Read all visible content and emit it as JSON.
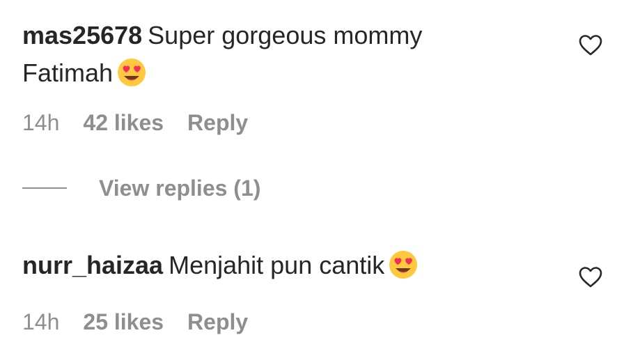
{
  "comments": [
    {
      "username": "mas25678",
      "text_line1": "Super gorgeous mommy",
      "text_line2": "Fatimah",
      "emoji": "heart-eyes-emoji",
      "time": "14h",
      "likes": "42 likes",
      "reply": "Reply",
      "view_replies": "View replies (1)"
    },
    {
      "username": "nurr_haizaa",
      "text": "Menjahit pun cantik",
      "emoji": "heart-eyes-emoji",
      "time": "14h",
      "likes": "25 likes",
      "reply": "Reply"
    }
  ],
  "colors": {
    "text": "#262626",
    "secondary": "#8e8e8e",
    "emoji_face": "#FFC83D",
    "emoji_heart": "#F0305A"
  }
}
